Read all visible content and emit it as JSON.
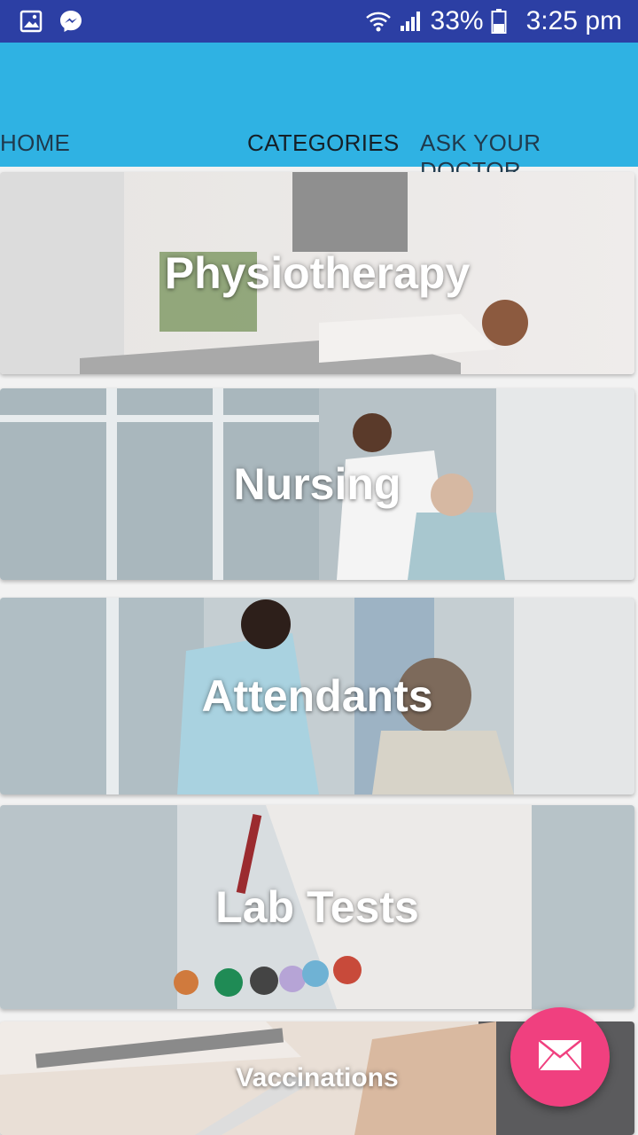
{
  "status_bar": {
    "battery": "33%",
    "time": "3:25 pm",
    "icons": [
      "gallery-icon",
      "messenger-icon",
      "wifi-icon",
      "signal-icon",
      "battery-icon"
    ]
  },
  "tabs": [
    {
      "label": "HOME"
    },
    {
      "label": "CATEGORIES",
      "active": true
    },
    {
      "label": "ASK YOUR DOCTOR"
    }
  ],
  "categories": [
    {
      "label": "Physiotherapy"
    },
    {
      "label": "Nursing"
    },
    {
      "label": "Attendants"
    },
    {
      "label": "Lab Tests"
    },
    {
      "label": "Vaccinations"
    }
  ],
  "fab": {
    "icon": "mail-icon"
  },
  "colors": {
    "status_bar": "#2c3fa4",
    "app_bar": "#2fb2e3",
    "fab": "#f0407f"
  }
}
